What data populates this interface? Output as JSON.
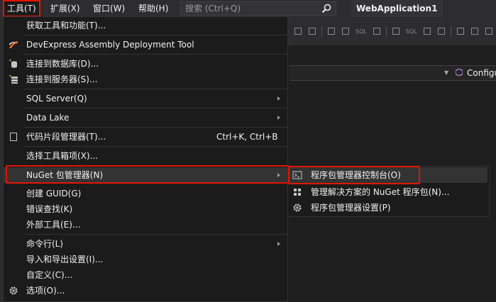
{
  "menubar": {
    "tools": "工具(T)",
    "extensions": "扩展(X)",
    "window": "窗口(W)",
    "help": "帮助(H)",
    "search_placeholder": "搜索 (Ctrl+Q)",
    "app_title": "WebApplication1"
  },
  "toolbar": {
    "sql_label": "SQL"
  },
  "nav": {
    "config_label": "Configu"
  },
  "tools_menu": {
    "items": [
      {
        "label": "获取工具和功能(T)...",
        "shortcut": ""
      },
      {
        "label": "DevExpress Assembly Deployment Tool",
        "shortcut": ""
      },
      {
        "label": "连接到数据库(D)...",
        "shortcut": ""
      },
      {
        "label": "连接到服务器(S)...",
        "shortcut": ""
      },
      {
        "label": "SQL Server(Q)",
        "shortcut": ""
      },
      {
        "label": "Data Lake",
        "shortcut": ""
      },
      {
        "label": "代码片段管理器(T)...",
        "shortcut": "Ctrl+K, Ctrl+B"
      },
      {
        "label": "选择工具箱项(X)...",
        "shortcut": ""
      },
      {
        "label": "NuGet 包管理器(N)",
        "shortcut": ""
      },
      {
        "label": "创建 GUID(G)",
        "shortcut": ""
      },
      {
        "label": "错误查找(K)",
        "shortcut": ""
      },
      {
        "label": "外部工具(E)...",
        "shortcut": ""
      },
      {
        "label": "命令行(L)",
        "shortcut": ""
      },
      {
        "label": "导入和导出设置(I)...",
        "shortcut": ""
      },
      {
        "label": "自定义(C)...",
        "shortcut": ""
      },
      {
        "label": "选项(O)...",
        "shortcut": ""
      }
    ]
  },
  "nuget_submenu": {
    "items": [
      {
        "label": "程序包管理器控制台(O)"
      },
      {
        "label": "管理解决方案的 NuGet 程序包(N)..."
      },
      {
        "label": "程序包管理器设置(P)"
      }
    ]
  },
  "colors": {
    "highlight_border": "#e51400",
    "menu_bg": "#1b1b1c",
    "hover_bg": "#333334",
    "text": "#f1f1f1"
  }
}
